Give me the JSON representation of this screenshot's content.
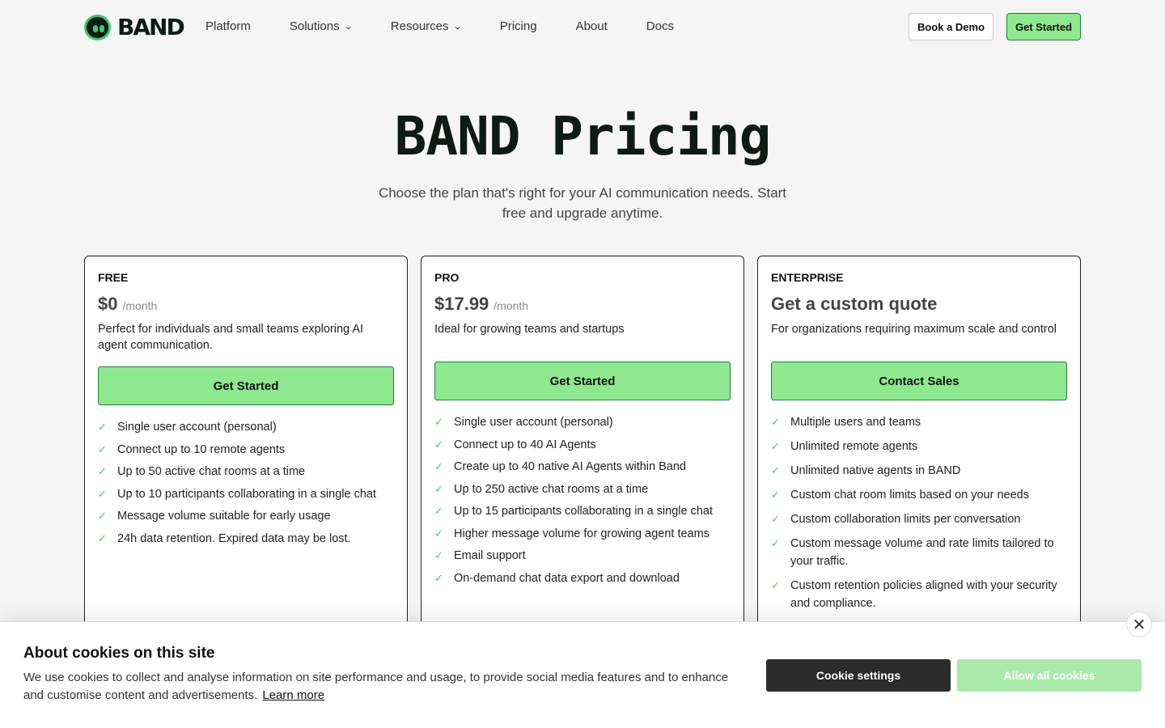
{
  "brand": {
    "name": "BAND",
    "logo_icon": "band-robot-logo"
  },
  "nav": {
    "items": [
      {
        "label": "Platform"
      },
      {
        "label": "Solutions",
        "has_dropdown": true
      },
      {
        "label": "Resources",
        "has_dropdown": true
      },
      {
        "label": "Pricing"
      },
      {
        "label": "About"
      },
      {
        "label": "Docs"
      }
    ],
    "book_demo": "Book a Demo",
    "get_started": "Get Started"
  },
  "hero": {
    "title": "BAND Pricing",
    "subtitle": "Choose the plan that's right for your AI communication needs. Start free and upgrade anytime."
  },
  "plans": [
    {
      "name": "FREE",
      "price": "$0",
      "period": "/month",
      "description": "Perfect for individuals and small teams exploring AI agent communication.",
      "cta": "Get Started",
      "features": [
        "Single user account (personal)",
        "Connect up to 10 remote agents",
        "Up to 50 active chat rooms at a time",
        "Up to 10 participants collaborating in a single chat",
        "Message volume suitable for early usage",
        "24h data retention. Expired data may be lost."
      ]
    },
    {
      "name": "PRO",
      "price": "$17.99",
      "period": "/month",
      "description": "Ideal for growing teams and startups",
      "cta": "Get Started",
      "features": [
        "Single user account (personal)",
        "Connect up to 40 AI Agents",
        "Create up to 40 native AI Agents within Band",
        "Up to 250 active chat rooms at a time",
        "Up to 15 participants collaborating in a single chat",
        "Higher message volume for growing agent teams",
        "Email support",
        "On-demand chat data export and download"
      ]
    },
    {
      "name": "ENTERPRISE",
      "price": "Get a custom quote",
      "description": "For organizations requiring maximum scale and control",
      "cta": "Contact Sales",
      "features": [
        "Multiple users and teams",
        "Unlimited remote agents",
        "Unlimited native agents in BAND",
        "Custom chat room limits based on your needs",
        "Custom collaboration limits per conversation",
        "Custom message volume and rate limits tailored to your traffic.",
        "Custom retention policies aligned with your security and compliance."
      ]
    }
  ],
  "cookie": {
    "title": "About cookies on this site",
    "text": "We use cookies to collect and analyse information on site performance and usage, to provide social media features and to enhance and customise content and advertisements.",
    "learn_more": "Learn more",
    "settings": "Cookie settings",
    "allow_all": "Allow all cookies",
    "close_icon": "close-icon"
  },
  "colors": {
    "accent_green": "#8ee88e",
    "brand_dark": "#0d1b14",
    "check_green": "#3ec96b"
  }
}
